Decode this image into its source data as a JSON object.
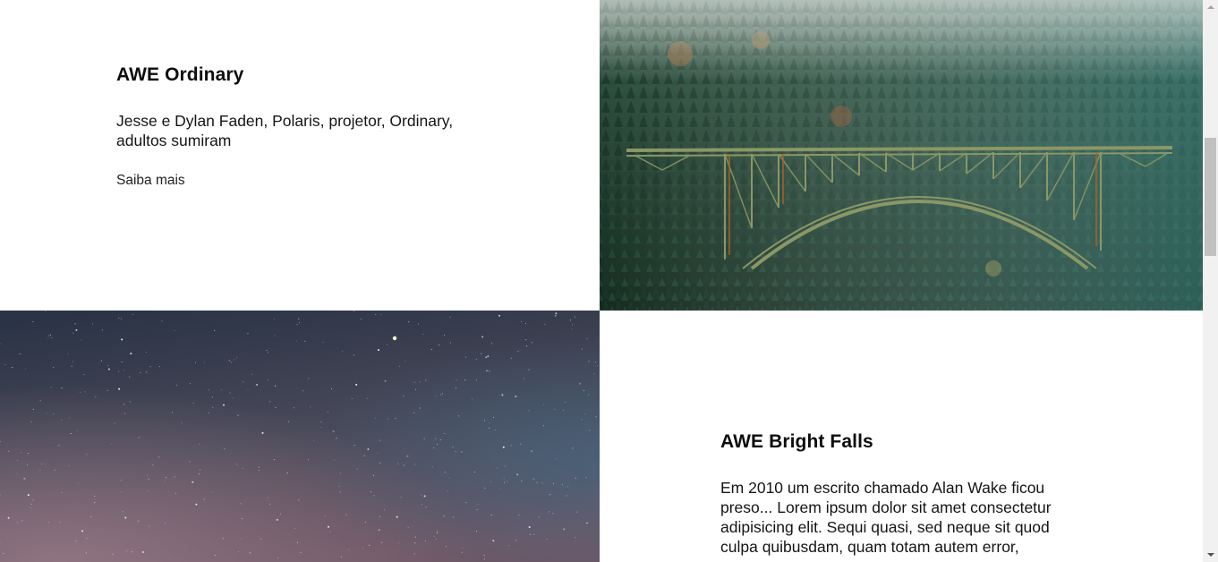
{
  "cards": [
    {
      "title": "AWE Ordinary",
      "description": "Jesse e Dylan Faden, Polaris, projetor, Ordinary, adultos sumiram",
      "link_label": "Saiba mais",
      "image": "forest-bridge-photo"
    },
    {
      "title": "AWE Bright Falls",
      "description": "Em 2010 um escrito chamado Alan Wake ficou preso... Lorem ipsum dolor sit amet consectetur adipisicing elit. Sequi quasi, sed neque sit quod culpa quibusdam, quam totam autem error,",
      "image": "night-sky-stars-photo"
    }
  ],
  "colors": {
    "background": "#ffffff",
    "text": "#111111",
    "forest_dark": "#1d3a2c",
    "bridge": "#7d8a5a",
    "sky_top": "#2e3d52",
    "sky_bottom": "#6e5865"
  }
}
